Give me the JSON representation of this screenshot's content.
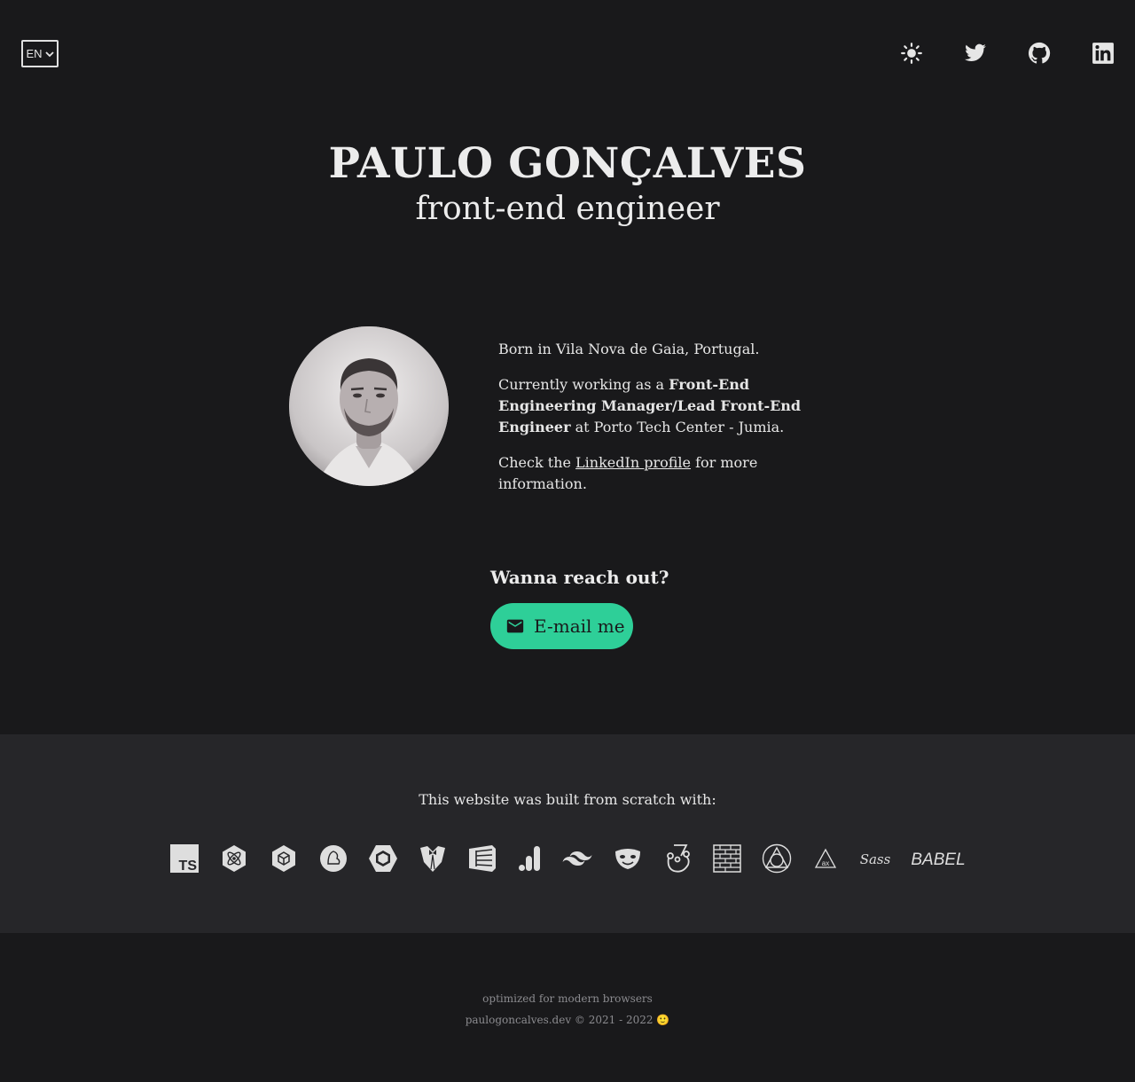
{
  "header": {
    "language": "EN",
    "icons": [
      "sun-icon",
      "twitter-icon",
      "github-icon",
      "linkedin-icon"
    ]
  },
  "hero": {
    "name": "PAULO GONÇALVES",
    "role": "front-end engineer"
  },
  "bio": {
    "line1": "Born in Vila Nova de Gaia, Portugal.",
    "line2_prefix": "Currently working as a ",
    "line2_bold": "Front-End Engineering Manager/Lead Front-End Engineer",
    "line2_suffix": " at Porto Tech Center - Jumia.",
    "line3_prefix": "Check the ",
    "line3_link": "LinkedIn profile",
    "line3_suffix": " for more information."
  },
  "contact": {
    "heading": "Wanna reach out?",
    "button_label": "E-mail me"
  },
  "built_with": {
    "heading": "This website was built from scratch with:",
    "ts_label": "TS",
    "babel_label": "BABEL",
    "sass_label": "Sass",
    "tech_icons": [
      "typescript-icon",
      "preact-icon",
      "webpack-icon",
      "parcel-icon",
      "stylelint-icon",
      "tuxedo-icon",
      "eslint-icon",
      "analytics-icon",
      "tailwind-icon",
      "playwright-icon",
      "jest-icon",
      "pattern-icon",
      "lighthouse-icon",
      "ax-icon",
      "sass-icon",
      "babel-icon"
    ]
  },
  "footer": {
    "line1": "optimized for modern browsers",
    "line2": "paulogoncalves.dev © 2021 - 2022 🙂"
  },
  "colors": {
    "background": "#19191b",
    "panel": "#262629",
    "accent": "#2ecf98",
    "text": "#e6e6e6",
    "muted": "#8b8b8f"
  }
}
